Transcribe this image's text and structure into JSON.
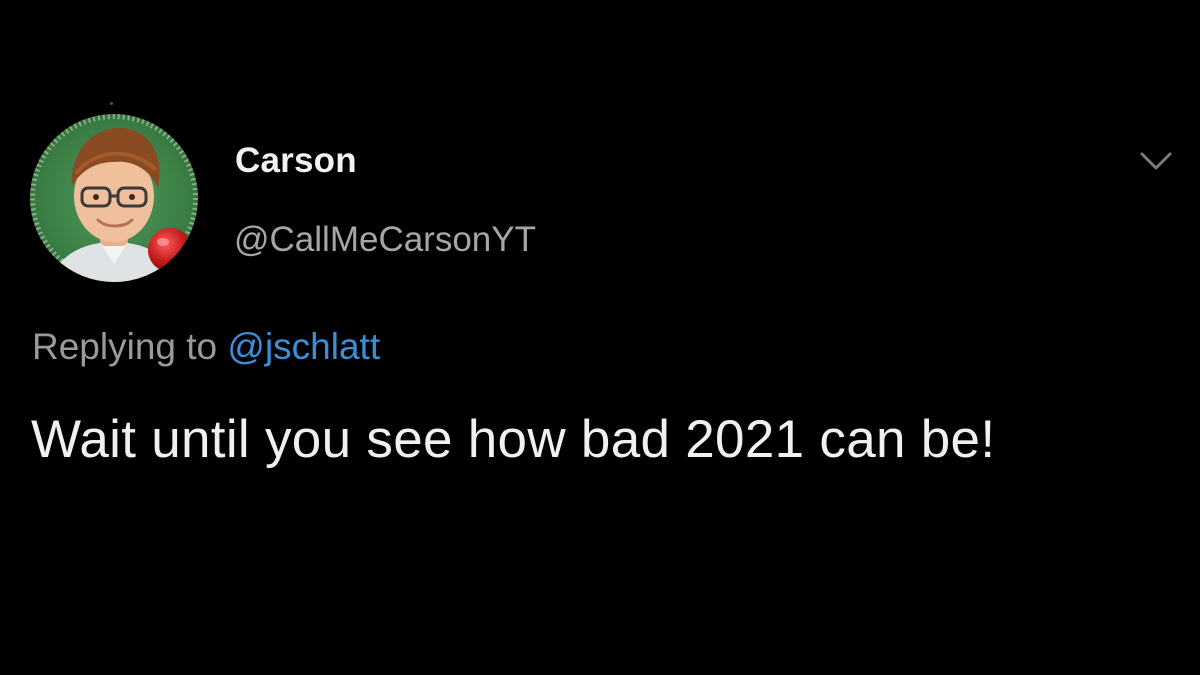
{
  "tweet": {
    "author": {
      "display_name": "Carson",
      "handle": "@CallMeCarsonYT",
      "avatar_icon": "profile-photo"
    },
    "reply": {
      "prefix": "Replying to",
      "mention": "@jschlatt"
    },
    "text": "Wait until you see how bad 2021 can be!",
    "more_icon": "chevron-down-icon"
  },
  "colors": {
    "background": "#000000",
    "display_name": "#f2f2f2",
    "handle": "#a6a6a6",
    "reply_prefix": "#9a9a9a",
    "mention": "#3a8fd9",
    "text": "#f0f0f0"
  }
}
